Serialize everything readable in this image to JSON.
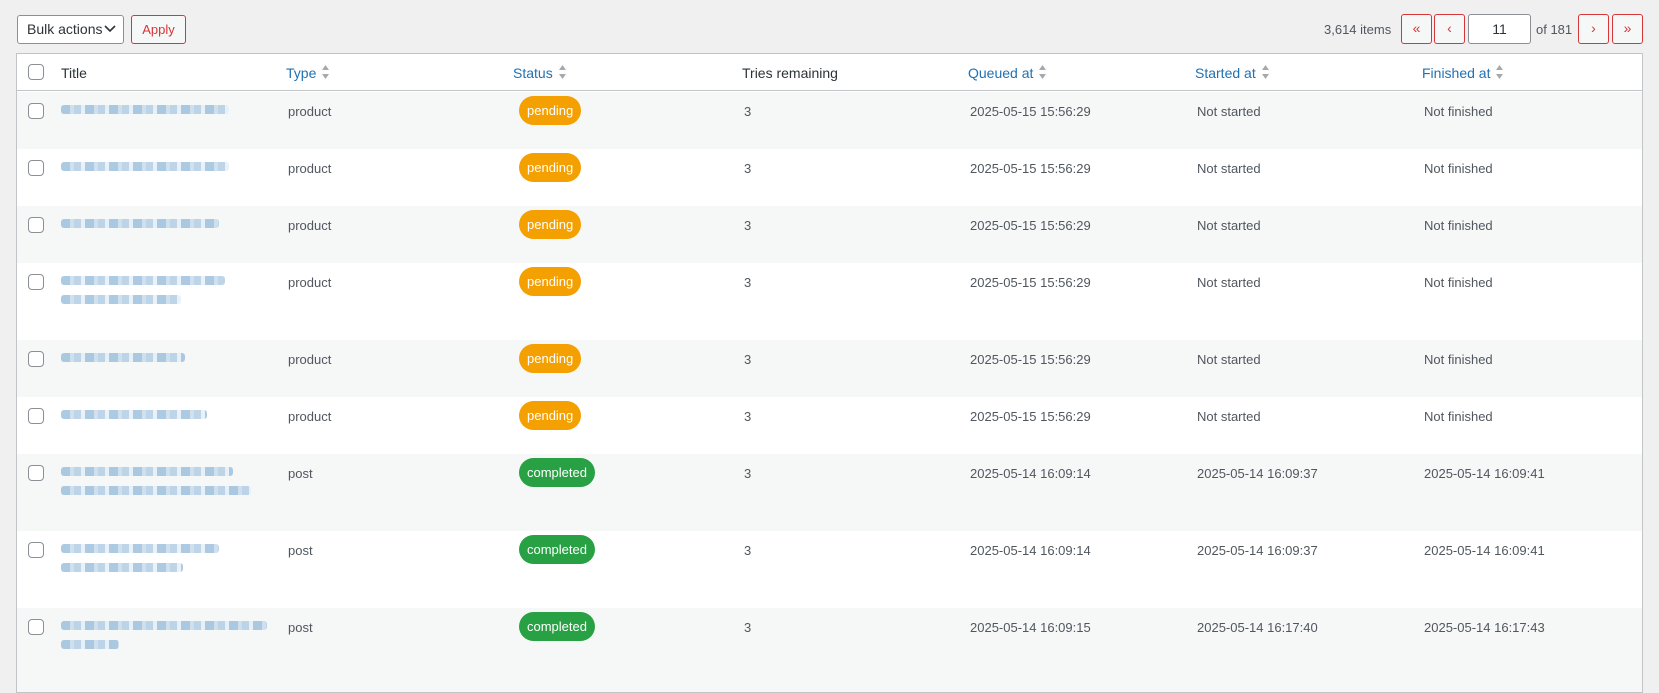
{
  "toolbar": {
    "bulk_actions_label": "Bulk actions",
    "apply_label": "Apply"
  },
  "pagination": {
    "items_count": "3,614 items",
    "first_label": "«",
    "prev_label": "‹",
    "current_page": "11",
    "of_total": "of 181",
    "next_label": "›",
    "last_label": "»"
  },
  "columns": {
    "title": "Title",
    "type": "Type",
    "status": "Status",
    "tries": "Tries remaining",
    "queued": "Queued at",
    "started": "Started at",
    "finished": "Finished at"
  },
  "rows": [
    {
      "type": "product",
      "status": "pending",
      "tries": "3",
      "queued": "2025-05-15 15:56:29",
      "started": "Not started",
      "finished": "Not finished"
    },
    {
      "type": "product",
      "status": "pending",
      "tries": "3",
      "queued": "2025-05-15 15:56:29",
      "started": "Not started",
      "finished": "Not finished"
    },
    {
      "type": "product",
      "status": "pending",
      "tries": "3",
      "queued": "2025-05-15 15:56:29",
      "started": "Not started",
      "finished": "Not finished"
    },
    {
      "type": "product",
      "status": "pending",
      "tries": "3",
      "queued": "2025-05-15 15:56:29",
      "started": "Not started",
      "finished": "Not finished"
    },
    {
      "type": "product",
      "status": "pending",
      "tries": "3",
      "queued": "2025-05-15 15:56:29",
      "started": "Not started",
      "finished": "Not finished"
    },
    {
      "type": "product",
      "status": "pending",
      "tries": "3",
      "queued": "2025-05-15 15:56:29",
      "started": "Not started",
      "finished": "Not finished"
    },
    {
      "type": "post",
      "status": "completed",
      "tries": "3",
      "queued": "2025-05-14 16:09:14",
      "started": "2025-05-14 16:09:37",
      "finished": "2025-05-14 16:09:41"
    },
    {
      "type": "post",
      "status": "completed",
      "tries": "3",
      "queued": "2025-05-14 16:09:14",
      "started": "2025-05-14 16:09:37",
      "finished": "2025-05-14 16:09:41"
    },
    {
      "type": "post",
      "status": "completed",
      "tries": "3",
      "queued": "2025-05-14 16:09:15",
      "started": "2025-05-14 16:17:40",
      "finished": "2025-05-14 16:17:43"
    }
  ],
  "colors": {
    "link": "#2271b1",
    "pending": "#f4a000",
    "completed": "#27a143",
    "danger": "#d63638"
  }
}
